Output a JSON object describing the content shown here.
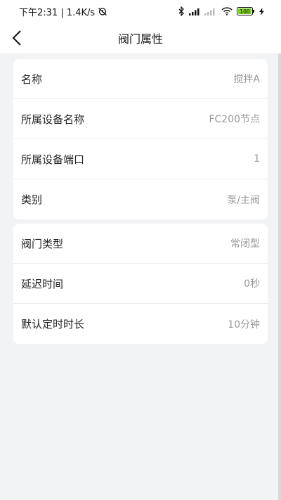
{
  "status_bar": {
    "time_speed": "下午2:31 | 1.4K/s",
    "battery": "100"
  },
  "nav": {
    "title": "阀门属性"
  },
  "groups": [
    {
      "rows": [
        {
          "label": "名称",
          "value": "搅拌A"
        },
        {
          "label": "所属设备名称",
          "value": "FC200节点"
        },
        {
          "label": "所属设备端口",
          "value": "1"
        },
        {
          "label": "类别",
          "value": "泵/主阀"
        }
      ]
    },
    {
      "rows": [
        {
          "label": "阀门类型",
          "value": "常闭型"
        },
        {
          "label": "延迟时间",
          "value": "0秒"
        },
        {
          "label": "默认定时时长",
          "value": "10分钟"
        }
      ]
    }
  ],
  "icons": {
    "back": "chevron-left-icon",
    "alarm": "alarm-off-icon",
    "bluetooth": "bluetooth-icon",
    "signal": "signal-icon",
    "wifi": "wifi-icon",
    "battery": "battery-icon",
    "charging": "charging-icon"
  },
  "colors": {
    "background": "#f2f3f5",
    "card": "#ffffff",
    "label": "#222222",
    "value": "#999999",
    "battery_fill": "#7ed321"
  }
}
